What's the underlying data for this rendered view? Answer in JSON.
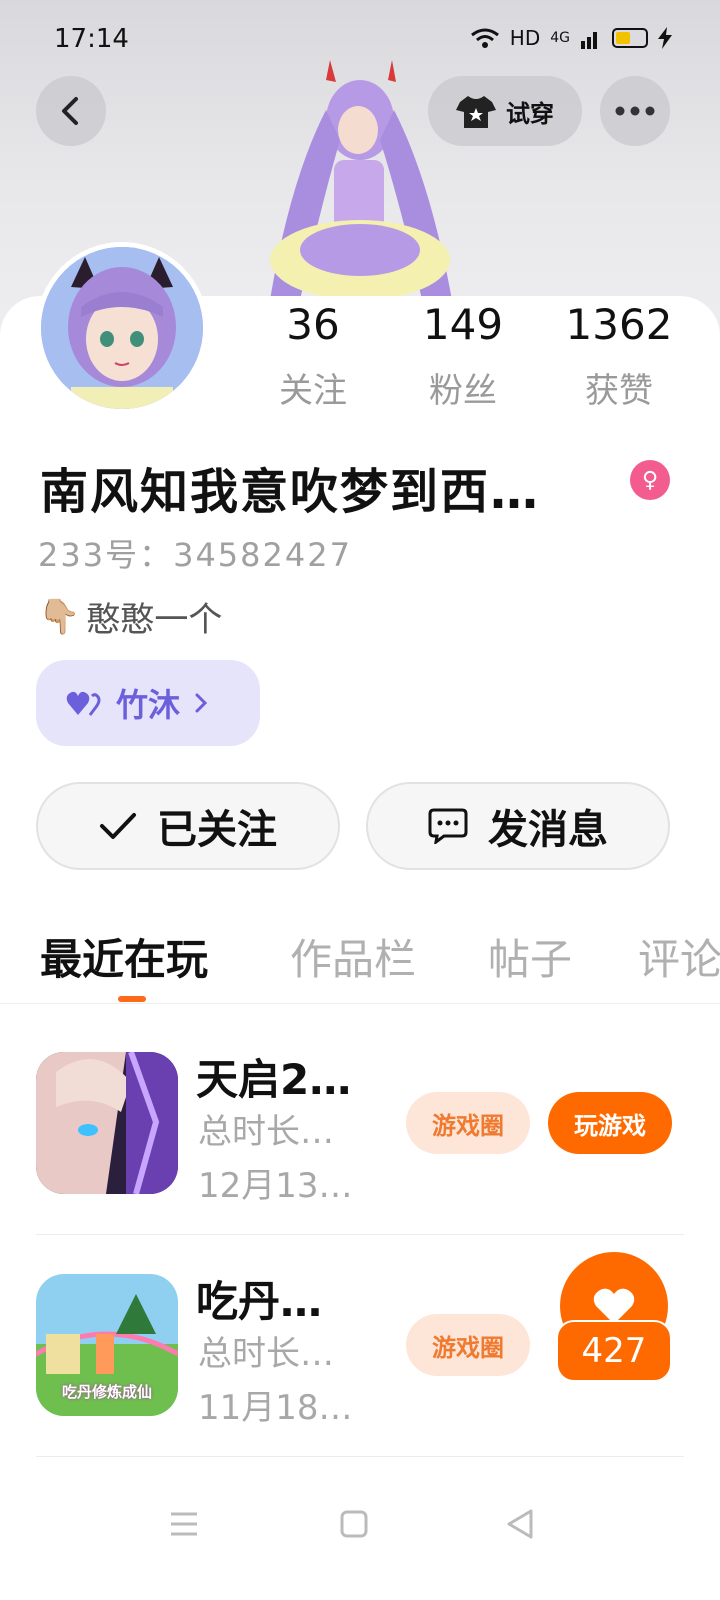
{
  "status_bar": {
    "time": "17:14",
    "network": "HD",
    "signal": "4G"
  },
  "header": {
    "tryon_label": "试穿"
  },
  "profile": {
    "stats": [
      {
        "value": "36",
        "label": "关注"
      },
      {
        "value": "149",
        "label": "粉丝"
      },
      {
        "value": "1362",
        "label": "获赞"
      }
    ],
    "username": "南风知我意吹梦到西…",
    "gender": "female",
    "user_id": "233号：34582427",
    "bio_emoji": "👇🏼",
    "bio": "憨憨一个",
    "partner_chip": "竹沐"
  },
  "actions": {
    "follow_label": "已关注",
    "message_label": "发消息"
  },
  "tabs": [
    {
      "label": "最近在玩",
      "active": true
    },
    {
      "label": "作品栏",
      "active": false
    },
    {
      "label": "帖子",
      "active": false
    },
    {
      "label": "评论",
      "active": false
    }
  ],
  "games": [
    {
      "title": "天启2…",
      "duration": "总时长…",
      "date": "12月13…",
      "circle_label": "游戏圈",
      "play_label": "玩游戏"
    },
    {
      "title": "吃丹…",
      "duration": "总时长…",
      "date": "11月18…",
      "circle_label": "游戏圈",
      "thumb_caption": "吃丹修炼成仙"
    }
  ],
  "like_float": {
    "count": "427"
  },
  "colors": {
    "accent": "#ff6a00",
    "partner_bg": "#e6e4fb",
    "partner_fg": "#6b5fdc",
    "gender_badge": "#f25c8e"
  }
}
